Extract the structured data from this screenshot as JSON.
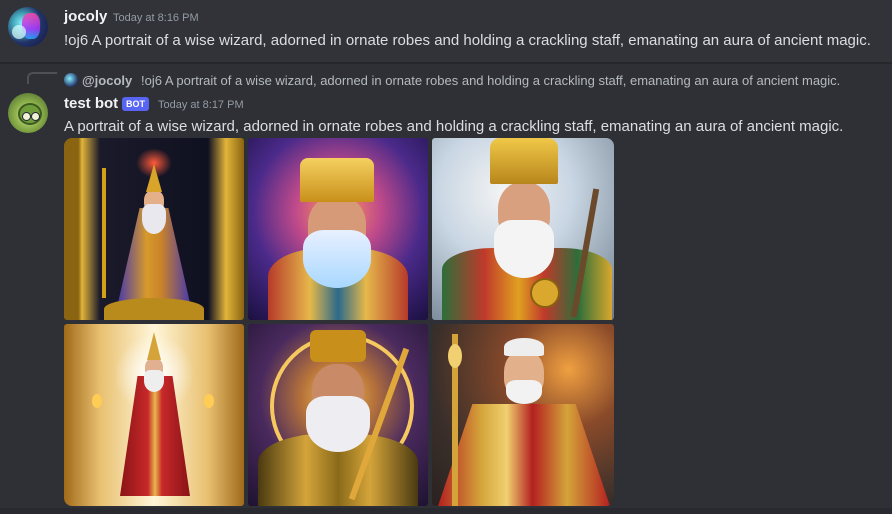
{
  "message1": {
    "username": "jocoly",
    "timestamp": "Today at 8:16 PM",
    "content": "!oj6 A portrait of a wise wizard, adorned in ornate robes and holding a crackling staff, emanating an aura of ancient magic."
  },
  "reply": {
    "username": "@jocoly",
    "content": "!oj6 A portrait of a wise wizard, adorned in ornate robes and holding a crackling staff, emanating an aura of ancient magic."
  },
  "message2": {
    "username": "test bot",
    "badge": "BOT",
    "timestamp": "Today at 8:17 PM",
    "content": "A portrait of a wise wizard, adorned in ornate robes and holding a crackling staff, emanating an aura of ancient magic."
  },
  "images": [
    {
      "name": "wizard-image-1",
      "palette": [
        "#1a1a2e",
        "#d4a017",
        "#5a3fa0"
      ]
    },
    {
      "name": "wizard-image-2",
      "palette": [
        "#3a1d5e",
        "#e8b84a",
        "#c0392b"
      ]
    },
    {
      "name": "wizard-image-3",
      "palette": [
        "#c9d6e3",
        "#d9a82c",
        "#2d6e3a"
      ]
    },
    {
      "name": "wizard-image-4",
      "palette": [
        "#c68a2a",
        "#f6e0a0",
        "#a8191b"
      ]
    },
    {
      "name": "wizard-image-5",
      "palette": [
        "#2a1b3d",
        "#e0a83a",
        "#6b4a1a"
      ]
    },
    {
      "name": "wizard-image-6",
      "palette": [
        "#3a2f2a",
        "#d4a43a",
        "#b32020"
      ]
    }
  ],
  "colors": {
    "background": "#313338",
    "badge": "#5865f2",
    "username": "#f2f3f5",
    "timestamp": "#949ba4"
  }
}
